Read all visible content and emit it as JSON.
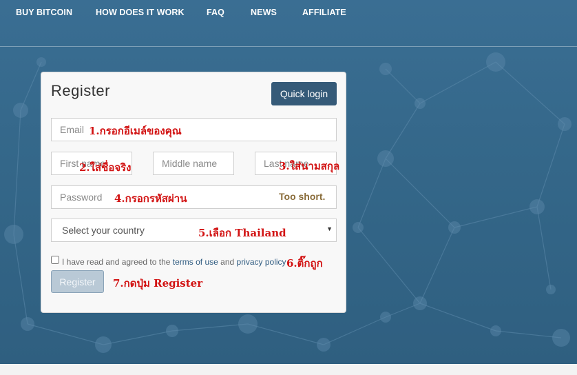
{
  "nav": {
    "items": [
      {
        "label": "BUY BITCOIN"
      },
      {
        "label": "HOW DOES IT WORK"
      },
      {
        "label": "FAQ"
      },
      {
        "label": "NEWS"
      },
      {
        "label": "AFFILIATE"
      }
    ]
  },
  "form": {
    "title": "Register",
    "quick_login_label": "Quick login",
    "email_placeholder": "Email",
    "first_name_placeholder": "First name",
    "middle_name_placeholder": "Middle name",
    "last_name_placeholder": "Last name",
    "password_placeholder": "Password",
    "password_status": "Too short.",
    "country_selected": "Select your country",
    "agree_prefix": "I have read and agreed to the ",
    "terms_link": "terms of use",
    "agree_and": " and ",
    "privacy_link": "privacy policy",
    "register_label": "Register"
  },
  "annotations": {
    "step1": "1.กรอกอีเมล์ของคุณ",
    "step2": "2.ใส่ชื่อจริง",
    "step3": "3.ใส่นามสกุล",
    "step4": "4.กรอกรหัสผ่าน",
    "step5": "5.เลือก Thailand",
    "step6": "6.ติ๊กถูก",
    "step7": "7.กดปุ่ม Register"
  },
  "colors": {
    "hero_bg": "#346789",
    "nav_text": "#ffffff",
    "quick_login_bg": "#355a78",
    "annotation_red": "#d21313",
    "warning_text": "#8a6d3b",
    "register_disabled_bg": "#b9c9d6"
  },
  "icons": {
    "select_caret": "caret-down-icon"
  }
}
